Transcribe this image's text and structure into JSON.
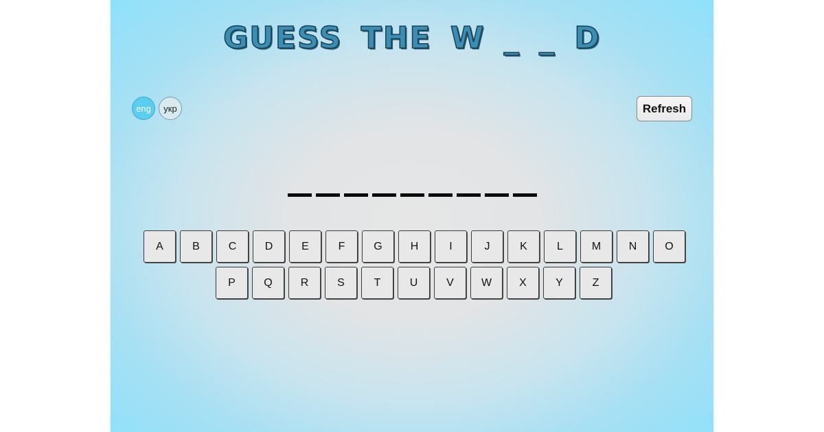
{
  "title": "GUESS THE W _ _ D",
  "language": {
    "options": [
      {
        "label": "eng",
        "active": true
      },
      {
        "label": "укр",
        "active": false
      }
    ]
  },
  "refresh_label": "Refresh",
  "word": {
    "letters_total": 9,
    "revealed": [
      "",
      "",
      "",
      "",
      "",
      "",
      "",
      "",
      ""
    ]
  },
  "keyboard": {
    "row1": [
      "A",
      "B",
      "C",
      "D",
      "E",
      "F",
      "G",
      "H",
      "I",
      "J",
      "K",
      "L",
      "M",
      "N",
      "O"
    ],
    "row2": [
      "P",
      "Q",
      "R",
      "S",
      "T",
      "U",
      "V",
      "W",
      "X",
      "Y",
      "Z"
    ]
  },
  "colors": {
    "accent": "#5bcdf0",
    "title": "#3a8db3",
    "background_edge": "#8ee1fb",
    "background_center": "#e6e6e6"
  }
}
